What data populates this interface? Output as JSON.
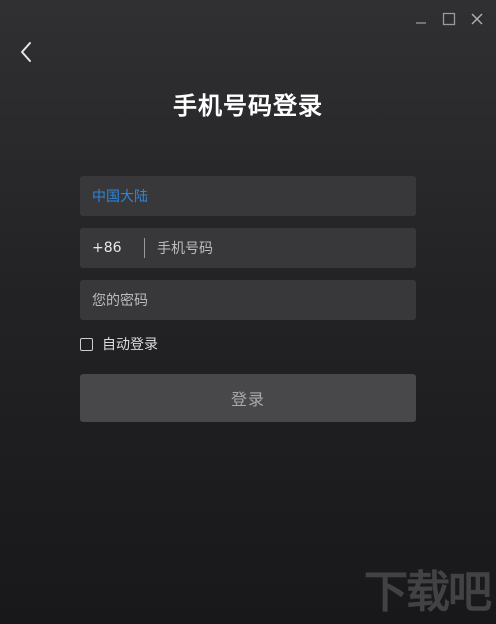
{
  "window": {
    "controls": [
      "minimize",
      "maximize",
      "close"
    ]
  },
  "header": {
    "back_icon": "chevron-left-icon",
    "title": "手机号码登录"
  },
  "form": {
    "region": "中国大陆",
    "country_code": "+86",
    "phone_placeholder": "手机号码",
    "password_placeholder": "您的密码",
    "remember_label": "自动登录",
    "remember_checked": false,
    "login_label": "登录"
  },
  "watermark": {
    "text": "下载吧"
  },
  "colors": {
    "background_top": "#303033",
    "background_bottom": "#18181a",
    "field_bg": "#38383b",
    "region_accent": "#2f86d6",
    "button_bg": "#48484b"
  }
}
